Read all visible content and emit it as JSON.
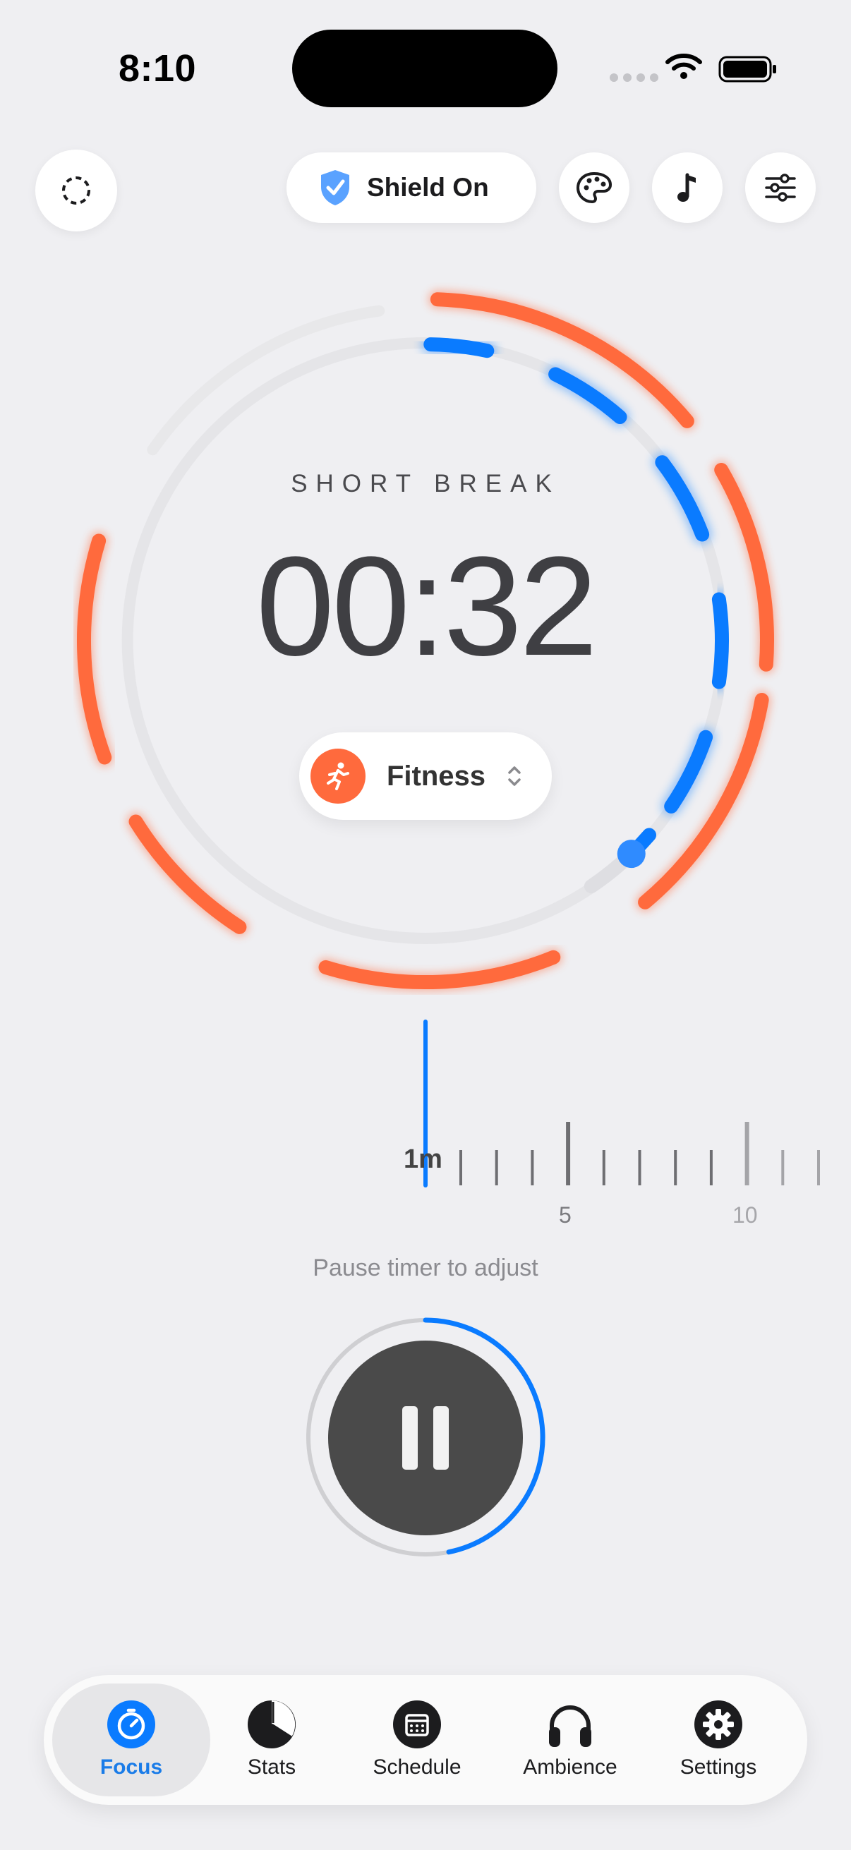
{
  "status_bar": {
    "time": "8:10"
  },
  "top_bar": {
    "shield_label": "Shield On"
  },
  "timer": {
    "mode_label": "SHORT BREAK",
    "time": "00:32",
    "category": "Fitness"
  },
  "ruler": {
    "current_label": "1m",
    "tick_labels": [
      "5",
      "10"
    ],
    "hint": "Pause timer to adjust"
  },
  "tabs": [
    {
      "label": "Focus",
      "icon": "timer-icon",
      "active": true
    },
    {
      "label": "Stats",
      "icon": "pie-chart-icon",
      "active": false
    },
    {
      "label": "Schedule",
      "icon": "calendar-icon",
      "active": false
    },
    {
      "label": "Ambience",
      "icon": "headphones-icon",
      "active": false
    },
    {
      "label": "Settings",
      "icon": "gear-icon",
      "active": false
    }
  ],
  "colors": {
    "accent": "#0a7bff",
    "orange": "#ff6a3d",
    "background": "#efeff2"
  }
}
